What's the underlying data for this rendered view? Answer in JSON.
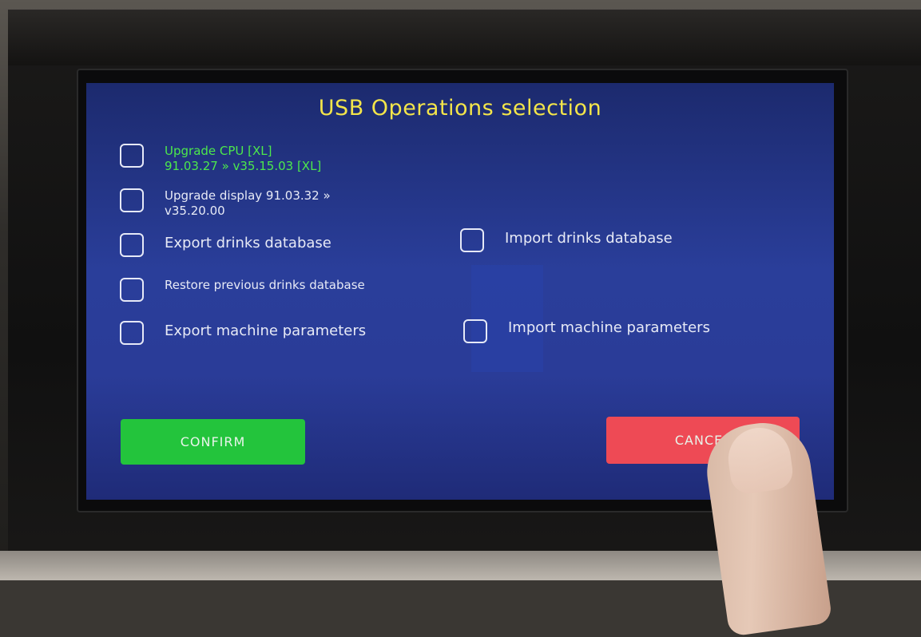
{
  "screen": {
    "title": "USB Operations selection",
    "options": {
      "upgrade_cpu": {
        "line1": "Upgrade CPU [XL]",
        "line2": "91.03.27 » v35.15.03 [XL]"
      },
      "upgrade_display": {
        "line1": "Upgrade display 91.03.32 »",
        "line2": "v35.20.00"
      },
      "export_drinks": {
        "label": "Export drinks database"
      },
      "import_drinks": {
        "label": "Import drinks database"
      },
      "restore_drinks": {
        "label": "Restore previous drinks database"
      },
      "export_params": {
        "label": "Export machine parameters"
      },
      "import_params": {
        "label": "Import machine parameters"
      }
    },
    "buttons": {
      "confirm": "CONFIRM",
      "cancel": "CANCEL"
    }
  },
  "colors": {
    "title": "#f3e54a",
    "highlight_option": "#4ce84c",
    "confirm_button": "#23c43c",
    "cancel_button": "#ee4a55",
    "screen_background": "#2a3e9a"
  },
  "icons": [
    "checkbox"
  ]
}
